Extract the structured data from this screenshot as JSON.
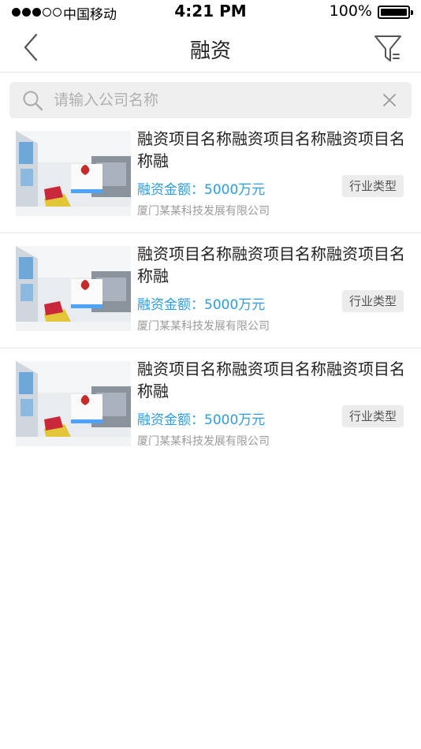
{
  "status_bar": {
    "signal_filled": 3,
    "signal_total": 5,
    "carrier": "中国移动",
    "time": "4:21 PM",
    "battery_text": "100%",
    "battery_level": 1.0
  },
  "navbar": {
    "title": "融资",
    "back_icon": "chevron-left-icon",
    "filter_icon": "funnel-icon"
  },
  "search": {
    "placeholder": "请输入公司名称",
    "value": "",
    "search_icon": "search-icon",
    "clear_icon": "close-icon"
  },
  "colors": {
    "accent": "#2f9be0",
    "search_bg": "#efefef",
    "tag_bg": "#ececec",
    "divider": "#e8e8e8"
  },
  "items": [
    {
      "title": "融资项目名称融资项目名称融资项目名称融",
      "amount": "融资金额：5000万元",
      "tag": "行业类型",
      "company": "厦门某某科技发展有限公司"
    },
    {
      "title": "融资项目名称融资项目名称融资项目名称融",
      "amount": "融资金额：5000万元",
      "tag": "行业类型",
      "company": "厦门某某科技发展有限公司"
    },
    {
      "title": "融资项目名称融资项目名称融资项目名称融",
      "amount": "融资金额：5000万元",
      "tag": "行业类型",
      "company": "厦门某某科技发展有限公司"
    }
  ]
}
